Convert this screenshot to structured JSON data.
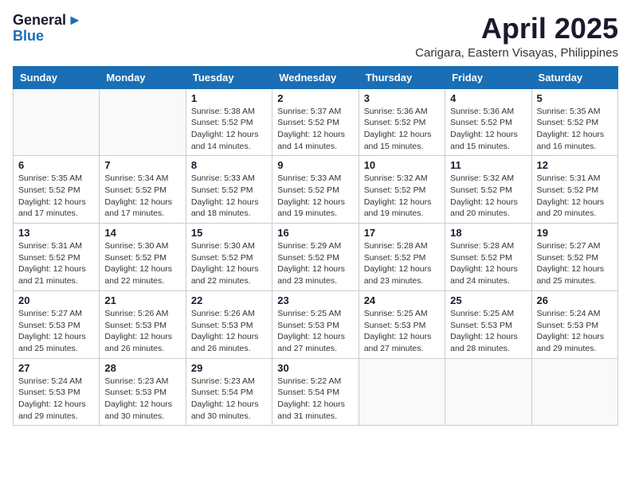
{
  "header": {
    "logo_line1": "General",
    "logo_line2": "Blue",
    "month": "April 2025",
    "location": "Carigara, Eastern Visayas, Philippines"
  },
  "days_of_week": [
    "Sunday",
    "Monday",
    "Tuesday",
    "Wednesday",
    "Thursday",
    "Friday",
    "Saturday"
  ],
  "weeks": [
    [
      {
        "day": "",
        "info": ""
      },
      {
        "day": "",
        "info": ""
      },
      {
        "day": "1",
        "info": "Sunrise: 5:38 AM\nSunset: 5:52 PM\nDaylight: 12 hours\nand 14 minutes."
      },
      {
        "day": "2",
        "info": "Sunrise: 5:37 AM\nSunset: 5:52 PM\nDaylight: 12 hours\nand 14 minutes."
      },
      {
        "day": "3",
        "info": "Sunrise: 5:36 AM\nSunset: 5:52 PM\nDaylight: 12 hours\nand 15 minutes."
      },
      {
        "day": "4",
        "info": "Sunrise: 5:36 AM\nSunset: 5:52 PM\nDaylight: 12 hours\nand 15 minutes."
      },
      {
        "day": "5",
        "info": "Sunrise: 5:35 AM\nSunset: 5:52 PM\nDaylight: 12 hours\nand 16 minutes."
      }
    ],
    [
      {
        "day": "6",
        "info": "Sunrise: 5:35 AM\nSunset: 5:52 PM\nDaylight: 12 hours\nand 17 minutes."
      },
      {
        "day": "7",
        "info": "Sunrise: 5:34 AM\nSunset: 5:52 PM\nDaylight: 12 hours\nand 17 minutes."
      },
      {
        "day": "8",
        "info": "Sunrise: 5:33 AM\nSunset: 5:52 PM\nDaylight: 12 hours\nand 18 minutes."
      },
      {
        "day": "9",
        "info": "Sunrise: 5:33 AM\nSunset: 5:52 PM\nDaylight: 12 hours\nand 19 minutes."
      },
      {
        "day": "10",
        "info": "Sunrise: 5:32 AM\nSunset: 5:52 PM\nDaylight: 12 hours\nand 19 minutes."
      },
      {
        "day": "11",
        "info": "Sunrise: 5:32 AM\nSunset: 5:52 PM\nDaylight: 12 hours\nand 20 minutes."
      },
      {
        "day": "12",
        "info": "Sunrise: 5:31 AM\nSunset: 5:52 PM\nDaylight: 12 hours\nand 20 minutes."
      }
    ],
    [
      {
        "day": "13",
        "info": "Sunrise: 5:31 AM\nSunset: 5:52 PM\nDaylight: 12 hours\nand 21 minutes."
      },
      {
        "day": "14",
        "info": "Sunrise: 5:30 AM\nSunset: 5:52 PM\nDaylight: 12 hours\nand 22 minutes."
      },
      {
        "day": "15",
        "info": "Sunrise: 5:30 AM\nSunset: 5:52 PM\nDaylight: 12 hours\nand 22 minutes."
      },
      {
        "day": "16",
        "info": "Sunrise: 5:29 AM\nSunset: 5:52 PM\nDaylight: 12 hours\nand 23 minutes."
      },
      {
        "day": "17",
        "info": "Sunrise: 5:28 AM\nSunset: 5:52 PM\nDaylight: 12 hours\nand 23 minutes."
      },
      {
        "day": "18",
        "info": "Sunrise: 5:28 AM\nSunset: 5:52 PM\nDaylight: 12 hours\nand 24 minutes."
      },
      {
        "day": "19",
        "info": "Sunrise: 5:27 AM\nSunset: 5:52 PM\nDaylight: 12 hours\nand 25 minutes."
      }
    ],
    [
      {
        "day": "20",
        "info": "Sunrise: 5:27 AM\nSunset: 5:53 PM\nDaylight: 12 hours\nand 25 minutes."
      },
      {
        "day": "21",
        "info": "Sunrise: 5:26 AM\nSunset: 5:53 PM\nDaylight: 12 hours\nand 26 minutes."
      },
      {
        "day": "22",
        "info": "Sunrise: 5:26 AM\nSunset: 5:53 PM\nDaylight: 12 hours\nand 26 minutes."
      },
      {
        "day": "23",
        "info": "Sunrise: 5:25 AM\nSunset: 5:53 PM\nDaylight: 12 hours\nand 27 minutes."
      },
      {
        "day": "24",
        "info": "Sunrise: 5:25 AM\nSunset: 5:53 PM\nDaylight: 12 hours\nand 27 minutes."
      },
      {
        "day": "25",
        "info": "Sunrise: 5:25 AM\nSunset: 5:53 PM\nDaylight: 12 hours\nand 28 minutes."
      },
      {
        "day": "26",
        "info": "Sunrise: 5:24 AM\nSunset: 5:53 PM\nDaylight: 12 hours\nand 29 minutes."
      }
    ],
    [
      {
        "day": "27",
        "info": "Sunrise: 5:24 AM\nSunset: 5:53 PM\nDaylight: 12 hours\nand 29 minutes."
      },
      {
        "day": "28",
        "info": "Sunrise: 5:23 AM\nSunset: 5:53 PM\nDaylight: 12 hours\nand 30 minutes."
      },
      {
        "day": "29",
        "info": "Sunrise: 5:23 AM\nSunset: 5:54 PM\nDaylight: 12 hours\nand 30 minutes."
      },
      {
        "day": "30",
        "info": "Sunrise: 5:22 AM\nSunset: 5:54 PM\nDaylight: 12 hours\nand 31 minutes."
      },
      {
        "day": "",
        "info": ""
      },
      {
        "day": "",
        "info": ""
      },
      {
        "day": "",
        "info": ""
      }
    ]
  ]
}
